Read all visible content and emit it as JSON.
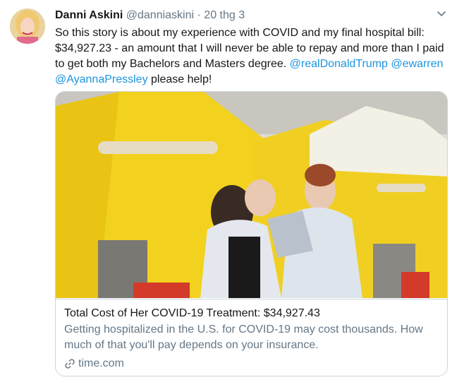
{
  "tweet": {
    "author_name": "Danni Askini",
    "author_handle": "@danniaskini",
    "separator": "·",
    "timestamp": "20 thg 3",
    "text_before": "So this story is about my experience with COVID and my final hospital bill: $34,927.23 - an amount that I will never be able to repay and more than I paid to get both my Bachelors and Masters degree.",
    "mention1": "@realDonaldTrump",
    "mention2": "@ewarren",
    "mention3": "@AyannaPressley",
    "text_after": "please help!"
  },
  "card": {
    "title": "Total Cost of Her COVID-19 Treatment: $34,927.43",
    "description": "Getting hospitalized in the U.S. for COVID-19 may cost thousands. How much of that you'll pay depends on your insurance.",
    "domain": "time.com",
    "link_icon": "link-icon"
  },
  "icons": {
    "caret": "chevron-down-icon",
    "link": "link-icon"
  },
  "colors": {
    "link": "#1b95e0",
    "secondary": "#657786",
    "border": "#ccd6dd",
    "tent_yellow": "#f2d21e"
  }
}
